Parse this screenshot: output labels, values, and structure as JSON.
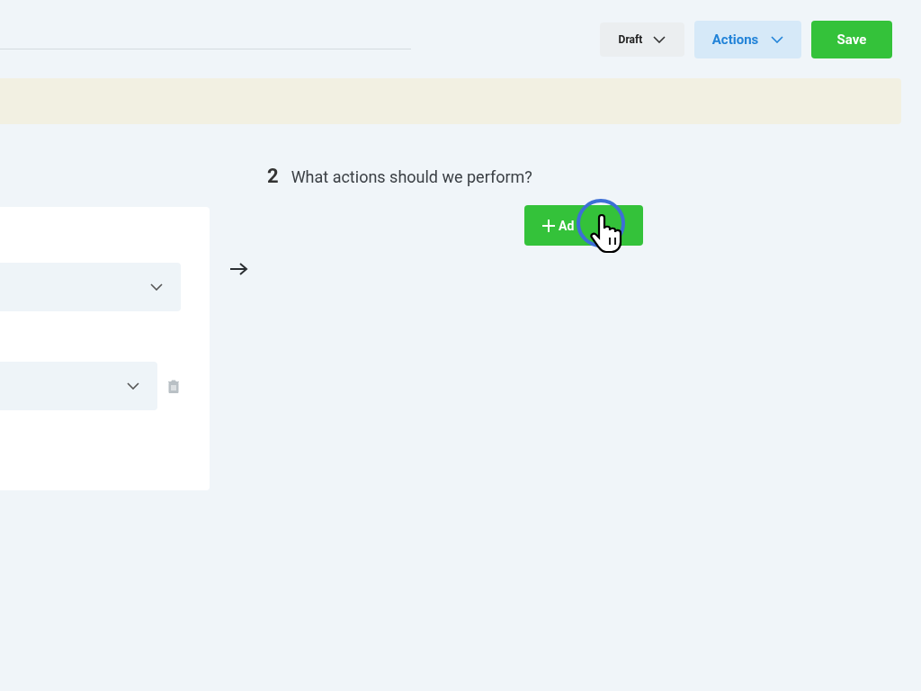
{
  "header": {
    "status_select": {
      "value": "Draft"
    },
    "actions_menu": {
      "label": "Actions"
    },
    "save_button": {
      "label": "Save"
    }
  },
  "rule_card": {
    "selects": [
      {
        "kind": "plain"
      },
      {
        "kind": "removable"
      }
    ]
  },
  "actions_step": {
    "number": "2",
    "question": "What actions should we perform?",
    "add_button": {
      "label": "Ad"
    }
  }
}
